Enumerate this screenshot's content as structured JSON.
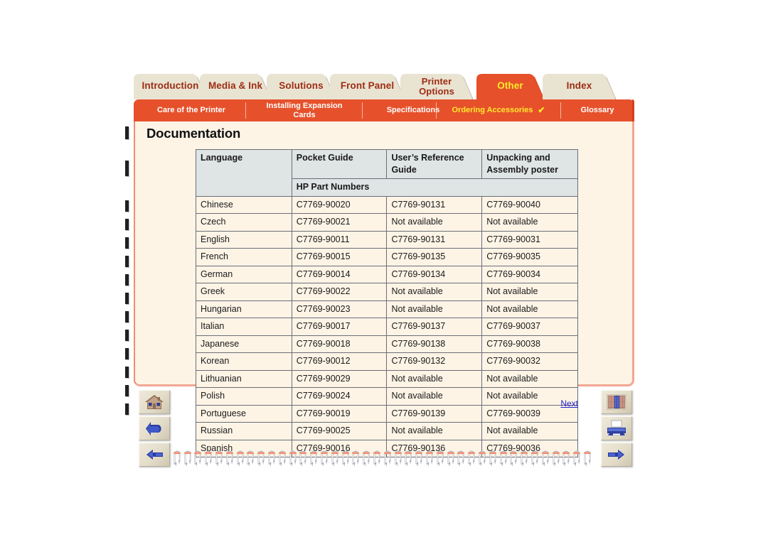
{
  "document": {
    "title": "Documentation",
    "next_label": "Next"
  },
  "tabs": [
    {
      "label": "Introduction",
      "name": "tab-introduction",
      "active": false
    },
    {
      "label": "Media & Ink",
      "name": "tab-media-and-ink",
      "active": false
    },
    {
      "label": "Solutions",
      "name": "tab-solutions",
      "active": false
    },
    {
      "label": "Front Panel",
      "name": "tab-front-panel",
      "active": false
    },
    {
      "label": "Printer\nOptions",
      "name": "tab-printer-options",
      "active": false
    },
    {
      "label": "Other",
      "name": "tab-other",
      "active": true
    },
    {
      "label": "Index",
      "name": "tab-index",
      "active": false
    }
  ],
  "subtabs": [
    {
      "label": "Care of the Printer",
      "name": "subtab-care-of-the-printer",
      "current": false,
      "check": ""
    },
    {
      "label": "Installing Expansion\nCards",
      "name": "subtab-installing-expansion-cards",
      "current": false,
      "check": ""
    },
    {
      "label": "Specifications",
      "name": "subtab-specifications",
      "current": false,
      "check": ""
    },
    {
      "label": "Ordering Accessories",
      "name": "subtab-ordering-accessories",
      "current": true,
      "check": "✔"
    },
    {
      "label": "Glossary",
      "name": "subtab-glossary",
      "current": false,
      "check": ""
    }
  ],
  "table": {
    "headers": [
      "Language",
      "Pocket Guide",
      "User’s Reference Guide",
      "Unpacking and Assembly poster"
    ],
    "subheader": "HP Part Numbers",
    "rows": [
      [
        "Chinese",
        "C7769-90020",
        "C7769-90131",
        "C7769-90040"
      ],
      [
        "Czech",
        "C7769-90021",
        "Not available",
        "Not available"
      ],
      [
        "English",
        "C7769-90011",
        "C7769-90131",
        "C7769-90031"
      ],
      [
        "French",
        "C7769-90015",
        "C7769-90135",
        "C7769-90035"
      ],
      [
        "German",
        "C7769-90014",
        "C7769-90134",
        "C7769-90034"
      ],
      [
        "Greek",
        "C7769-90022",
        "Not available",
        "Not available"
      ],
      [
        "Hungarian",
        "C7769-90023",
        "Not available",
        "Not available"
      ],
      [
        "Italian",
        "C7769-90017",
        "C7769-90137",
        "C7769-90037"
      ],
      [
        "Japanese",
        "C7769-90018",
        "C7769-90138",
        "C7769-90038"
      ],
      [
        "Korean",
        "C7769-90012",
        "C7769-90132",
        "C7769-90032"
      ],
      [
        "Lithuanian",
        "C7769-90029",
        "Not available",
        "Not available"
      ],
      [
        "Polish",
        "C7769-90024",
        "Not available",
        "Not available"
      ],
      [
        "Portuguese",
        "C7769-90019",
        "C7769-90139",
        "C7769-90039"
      ],
      [
        "Russian",
        "C7769-90025",
        "Not available",
        "Not available"
      ],
      [
        "Spanish",
        "C7769-90016",
        "C7769-90136",
        "C7769-90036"
      ]
    ]
  },
  "nav_left": [
    {
      "icon": "home-icon",
      "name": "nav-home-button"
    },
    {
      "icon": "back-arrow-icon",
      "name": "nav-back-button"
    },
    {
      "icon": "hand-left-icon",
      "name": "nav-previous-page-button"
    }
  ],
  "nav_right": [
    {
      "icon": "bookshelf-icon",
      "name": "nav-library-button"
    },
    {
      "icon": "printer-icon",
      "name": "nav-print-button"
    },
    {
      "icon": "hand-right-icon",
      "name": "nav-next-page-button"
    }
  ],
  "colors": {
    "accent_orange": "#e6512b",
    "active_tab_text": "#ffe92e",
    "inactive_tab_bg": "#e9e3d2",
    "inactive_tab_text": "#9c2d12",
    "page_bg": "#fdf4e6",
    "table_header_bg": "#dfe4e4",
    "link": "#2222cc"
  }
}
